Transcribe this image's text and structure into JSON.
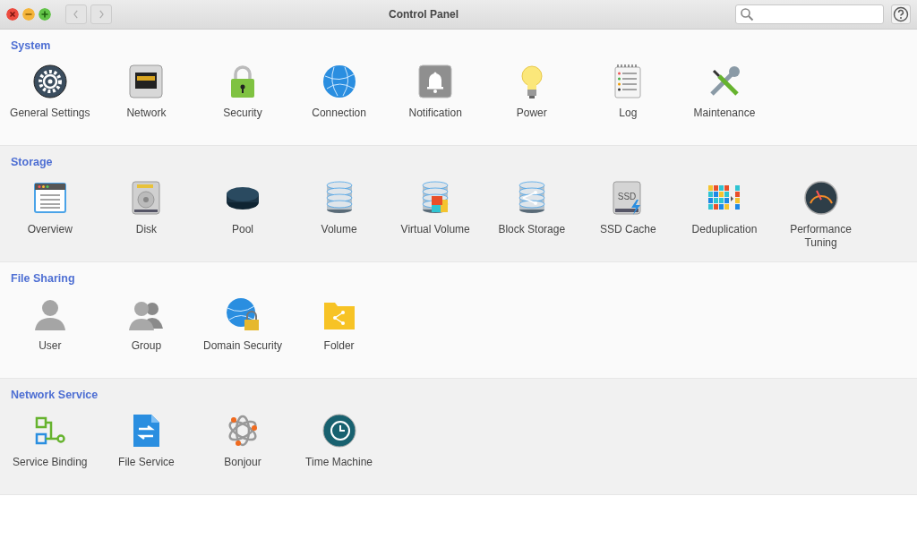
{
  "window": {
    "title": "Control Panel"
  },
  "sections": [
    {
      "title": "System",
      "items": [
        {
          "label": "General Settings"
        },
        {
          "label": "Network"
        },
        {
          "label": "Security"
        },
        {
          "label": "Connection"
        },
        {
          "label": "Notification"
        },
        {
          "label": "Power"
        },
        {
          "label": "Log"
        },
        {
          "label": "Maintenance"
        }
      ]
    },
    {
      "title": "Storage",
      "items": [
        {
          "label": "Overview"
        },
        {
          "label": "Disk"
        },
        {
          "label": "Pool"
        },
        {
          "label": "Volume"
        },
        {
          "label": "Virtual Volume"
        },
        {
          "label": "Block Storage"
        },
        {
          "label": "SSD Cache",
          "icon_text": "SSD"
        },
        {
          "label": "Deduplication"
        },
        {
          "label": "Performance Tuning"
        }
      ]
    },
    {
      "title": "File Sharing",
      "items": [
        {
          "label": "User"
        },
        {
          "label": "Group"
        },
        {
          "label": "Domain Security"
        },
        {
          "label": "Folder"
        }
      ]
    },
    {
      "title": "Network Service",
      "items": [
        {
          "label": "Service Binding"
        },
        {
          "label": "File Service"
        },
        {
          "label": "Bonjour"
        },
        {
          "label": "Time Machine"
        }
      ]
    }
  ]
}
